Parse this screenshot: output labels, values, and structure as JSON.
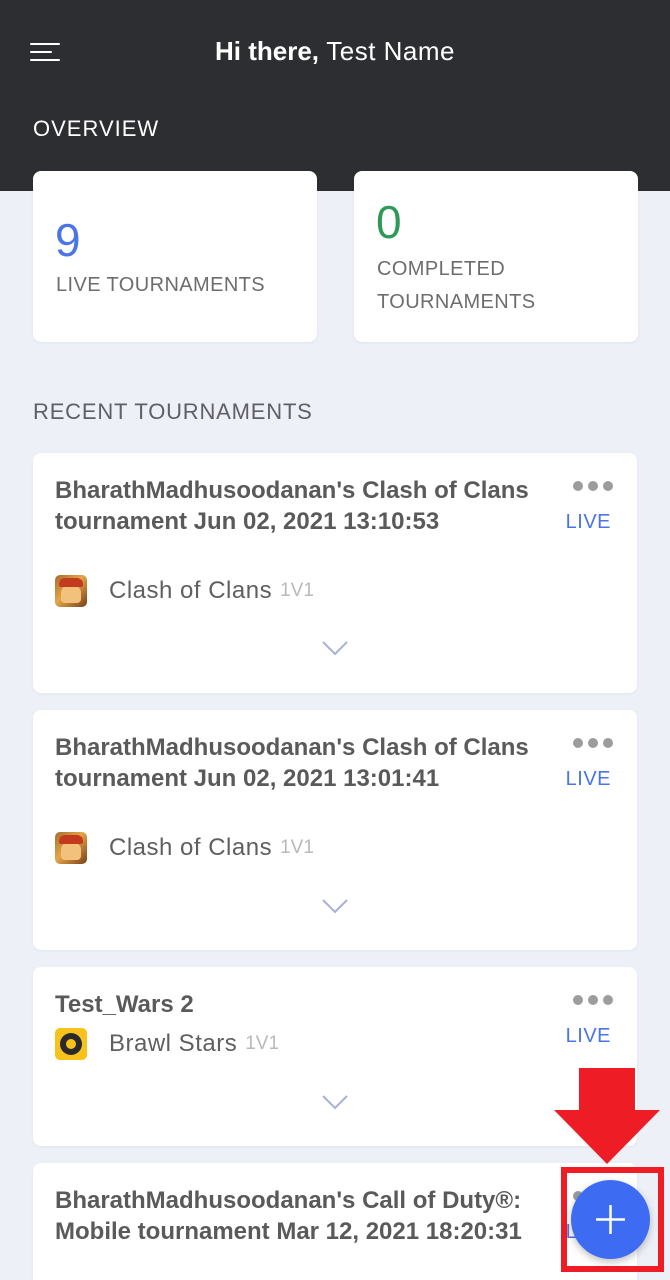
{
  "header": {
    "greeting_bold": "Hi there,",
    "user_name": "Test Name",
    "overview_title": "OVERVIEW",
    "menu_icon": "hamburger-menu-icon"
  },
  "stats": {
    "live": {
      "count": "9",
      "label": "LIVE TOURNAMENTS",
      "color": "#4a74e8"
    },
    "completed": {
      "count": "0",
      "label": "COMPLETED TOURNAMENTS",
      "color": "#2f9a57"
    }
  },
  "recent": {
    "title": "RECENT TOURNAMENTS",
    "tournaments": [
      {
        "title": "BharathMadhusoodanan's Clash of Clans tournament Jun 02, 2021 13:10:53",
        "game": "Clash of Clans",
        "mode": "1V1",
        "status": "LIVE",
        "icon": "clash-of-clans-icon"
      },
      {
        "title": "BharathMadhusoodanan's Clash of Clans tournament Jun 02, 2021 13:01:41",
        "game": "Clash of Clans",
        "mode": "1V1",
        "status": "LIVE",
        "icon": "clash-of-clans-icon"
      },
      {
        "title": "Test_Wars 2",
        "game": "Brawl Stars",
        "mode": "1V1",
        "status": "LIVE",
        "icon": "brawl-stars-icon"
      },
      {
        "title": "BharathMadhusoodanan's Call of Duty®: Mobile tournament Mar 12, 2021 18:20:31",
        "status": "LIVE"
      }
    ]
  },
  "colors": {
    "header_bg": "#2d2e32",
    "accent": "#4a74e8",
    "fab": "#3d6cf2",
    "annotation": "#ee1c25"
  },
  "fab": {
    "icon": "plus-icon"
  }
}
